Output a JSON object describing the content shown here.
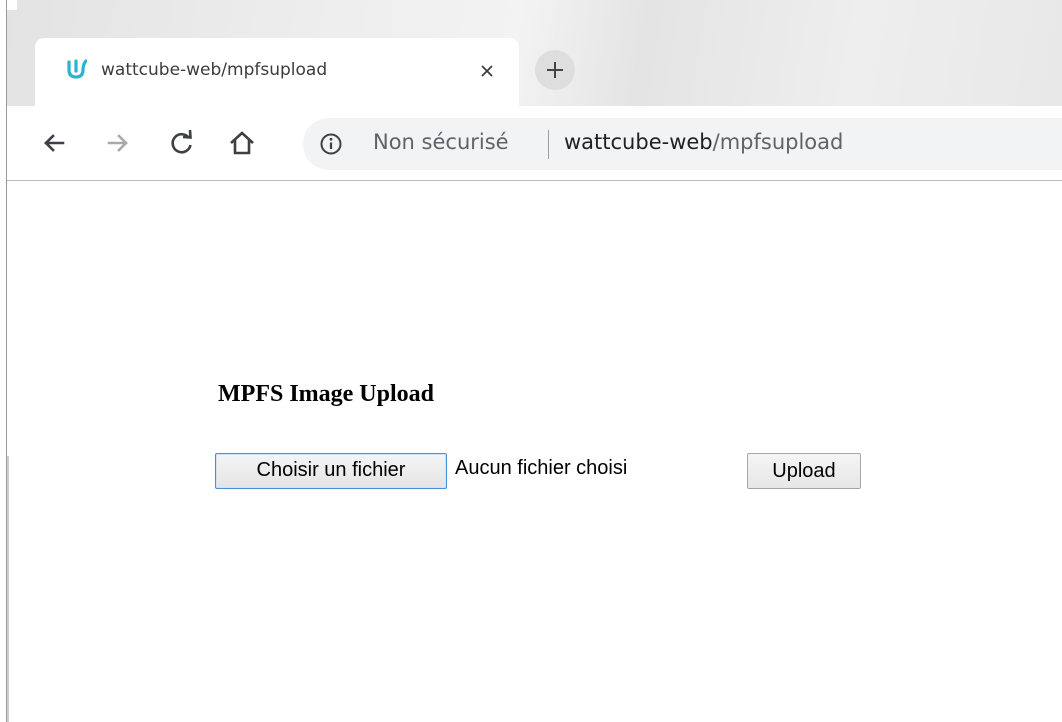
{
  "browser": {
    "tab": {
      "title": "wattcube-web/mpfsupload",
      "close_glyph": "×"
    },
    "new_tab_glyph": "+",
    "address_bar": {
      "security_label": "Non sécurisé",
      "url_host": "wattcube-web",
      "url_path": "/mpfsupload"
    },
    "icons": {
      "favicon": "wattcube-logo-icon",
      "back": "arrow-left-icon",
      "forward": "arrow-right-icon",
      "reload": "reload-icon",
      "home": "home-icon",
      "info": "info-icon"
    },
    "colors": {
      "favicon": "#2bb3cf",
      "toolbar_icon": "#5f6368",
      "forward_disabled": "#a8aaad",
      "focus_border": "#4a90d9"
    }
  },
  "page": {
    "title": "MPFS Image Upload",
    "file_input": {
      "button_label": "Choisir un fichier",
      "status_text": "Aucun fichier choisi"
    },
    "upload_button_label": "Upload"
  }
}
